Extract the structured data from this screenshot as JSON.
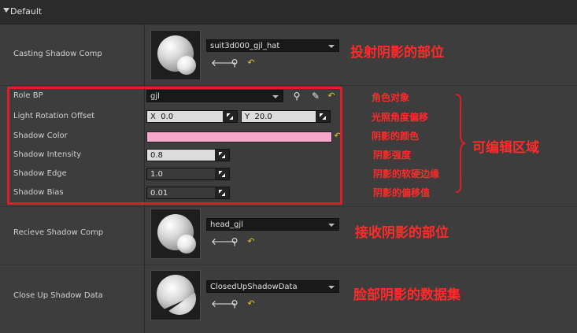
{
  "section": {
    "title": "Default"
  },
  "rows": {
    "casting": {
      "label": "Casting Shadow Comp",
      "value": "suit3d000_gjl_hat"
    },
    "role_bp": {
      "label": "Role BP",
      "value": "gjl"
    },
    "light_rotation": {
      "label": "Light Rotation Offset",
      "x_axis": "X",
      "x_value": "0.0",
      "y_axis": "Y",
      "y_value": "20.0"
    },
    "shadow_color": {
      "label": "Shadow Color",
      "color": "#f6a8cc"
    },
    "shadow_intensity": {
      "label": "Shadow Intensity",
      "value": "0.8"
    },
    "shadow_edge": {
      "label": "Shadow Edge",
      "value": "1.0"
    },
    "shadow_bias": {
      "label": "Shadow Bias",
      "value": "0.01"
    },
    "receive": {
      "label": "Recieve Shadow Comp",
      "value": "head_gjl"
    },
    "closeup": {
      "label": "Close Up Shadow Data",
      "value": "ClosedUpShadowData"
    }
  },
  "annotations": {
    "casting": "投射阴影的部位",
    "role": "角色对象",
    "light": "光照角度偏移",
    "color": "阴影的颜色",
    "intensity": "阴影强度",
    "edge": "阴影的软硬边缘",
    "bias": "阴影的偏移值",
    "editable": "可编辑区域",
    "receive": "接收阴影的部位",
    "closeup": "脸部阴影的数据集"
  },
  "colors": {
    "annotation_red": "#e11d2a",
    "reset_yellow": "#e6c229"
  },
  "icons": {
    "back": "back-arrow-icon",
    "browse": "browse-icon",
    "reset": "reset-icon",
    "pick": "eyedropper-icon"
  }
}
